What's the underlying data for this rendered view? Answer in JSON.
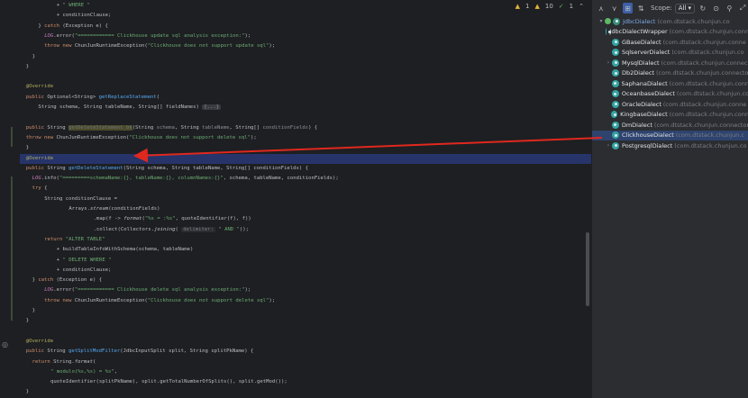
{
  "editor": {
    "inspections": {
      "warnings": "1",
      "weak_warnings": "10",
      "checks": "1"
    },
    "lines": [
      {
        "indent": 24,
        "parts": [
          [
            "op",
            "+ "
          ],
          [
            "str",
            "\" WHERE \""
          ]
        ]
      },
      {
        "indent": 24,
        "parts": [
          [
            "op",
            "+ conditionClause;"
          ]
        ]
      },
      {
        "indent": 12,
        "parts": [
          [
            "op",
            "} "
          ],
          [
            "kw",
            "catch"
          ],
          [
            "op",
            " (Exception e) {"
          ]
        ]
      },
      {
        "indent": 16,
        "parts": [
          [
            "lg",
            "LOG"
          ],
          [
            "op",
            ".error("
          ],
          [
            "str",
            "\"============ Clickhouse update sql analysis exception:\""
          ],
          [
            "op",
            ");"
          ]
        ]
      },
      {
        "indent": 16,
        "parts": [
          [
            "kw",
            "throw new "
          ],
          [
            "op",
            "ChunJunRuntimeException("
          ],
          [
            "str",
            "\"Clickhouse does not support update sql\""
          ],
          [
            "op",
            ");"
          ]
        ]
      },
      {
        "indent": 8,
        "parts": [
          [
            "op",
            "}"
          ]
        ]
      },
      {
        "indent": 4,
        "parts": [
          [
            "op",
            "}"
          ]
        ]
      },
      {
        "indent": 0,
        "parts": []
      },
      {
        "indent": 4,
        "parts": [
          [
            "ann",
            "@Override"
          ]
        ]
      },
      {
        "indent": 4,
        "parts": [
          [
            "kw",
            "public "
          ],
          [
            "op",
            "Optional<String> "
          ],
          [
            "fn",
            "getReplaceStatement"
          ],
          [
            "op",
            "("
          ]
        ]
      },
      {
        "indent": 12,
        "parts": [
          [
            "op",
            "String schema, String tableName, String[] fieldNames) "
          ],
          [
            "fold",
            "{...}"
          ]
        ]
      },
      {
        "indent": 0,
        "parts": []
      },
      {
        "indent": 4,
        "parts": [
          [
            "kw",
            "public "
          ],
          [
            "op",
            "String "
          ],
          [
            "unused",
            "getDeleteStatement_bk"
          ],
          [
            "op",
            "(String "
          ],
          [
            "par",
            "schema"
          ],
          [
            "op",
            ", String "
          ],
          [
            "par",
            "tableName"
          ],
          [
            "op",
            ", String[] "
          ],
          [
            "par",
            "conditionFields"
          ],
          [
            "op",
            ") {"
          ]
        ]
      },
      {
        "indent": 4,
        "parts": [
          [
            "kw",
            "throw new "
          ],
          [
            "op",
            "ChunJunRuntimeException("
          ],
          [
            "str",
            "\"Clickhouse does not support delete sql\""
          ],
          [
            "op",
            ");"
          ]
        ]
      },
      {
        "indent": 4,
        "parts": [
          [
            "op",
            "}"
          ]
        ]
      },
      {
        "indent": 4,
        "hl": true,
        "parts": [
          [
            "ann",
            "@Override"
          ]
        ]
      },
      {
        "indent": 4,
        "parts": [
          [
            "kw",
            "public "
          ],
          [
            "op",
            "String "
          ],
          [
            "fn",
            "getDeleteStatement"
          ],
          [
            "op",
            "(String schema, String tableName, String[] conditionFields) {"
          ]
        ]
      },
      {
        "indent": 8,
        "parts": [
          [
            "lg",
            "LOG"
          ],
          [
            "op",
            ".info("
          ],
          [
            "str",
            "\"=========schemaName:{}, tableName:{}, columnNames:{}\""
          ],
          [
            "op",
            ", schema, tableName, conditionFields);"
          ]
        ]
      },
      {
        "indent": 8,
        "parts": [
          [
            "kw",
            "try"
          ],
          [
            "op",
            " {"
          ]
        ]
      },
      {
        "indent": 16,
        "parts": [
          [
            "op",
            "String conditionClause ="
          ]
        ]
      },
      {
        "indent": 32,
        "parts": [
          [
            "op",
            "Arrays."
          ],
          [
            "it",
            "stream"
          ],
          [
            "op",
            "(conditionFields)"
          ]
        ]
      },
      {
        "indent": 48,
        "parts": [
          [
            "op",
            ".map(f -> "
          ],
          [
            "it",
            "format"
          ],
          [
            "op",
            "("
          ],
          [
            "str",
            "\"%s = :%s\""
          ],
          [
            "op",
            ", quoteIdentifier(f), f))"
          ]
        ]
      },
      {
        "indent": 48,
        "parts": [
          [
            "op",
            ".collect(Collectors."
          ],
          [
            "it",
            "joining"
          ],
          [
            "op",
            "( "
          ],
          [
            "hint",
            "delimiter:"
          ],
          [
            "str",
            " \" AND \""
          ],
          [
            "op",
            "));"
          ]
        ]
      },
      {
        "indent": 16,
        "parts": [
          [
            "kw",
            "return "
          ],
          [
            "str",
            "\"ALTER TABLE\""
          ]
        ]
      },
      {
        "indent": 24,
        "parts": [
          [
            "op",
            "+ buildTableInfoWithSchema(schema, tableName)"
          ]
        ]
      },
      {
        "indent": 24,
        "parts": [
          [
            "op",
            "+ "
          ],
          [
            "str",
            "\" DELETE WHERE \""
          ]
        ]
      },
      {
        "indent": 24,
        "parts": [
          [
            "op",
            "+ conditionClause;"
          ]
        ]
      },
      {
        "indent": 8,
        "parts": [
          [
            "op",
            "} "
          ],
          [
            "kw",
            "catch"
          ],
          [
            "op",
            " (Exception e) {"
          ]
        ]
      },
      {
        "indent": 16,
        "parts": [
          [
            "lg",
            "LOG"
          ],
          [
            "op",
            ".error("
          ],
          [
            "str",
            "\"============ Clickhouse delete sql analysis exception:\""
          ],
          [
            "op",
            ");"
          ]
        ]
      },
      {
        "indent": 16,
        "parts": [
          [
            "kw",
            "throw new "
          ],
          [
            "op",
            "ChunJunRuntimeException("
          ],
          [
            "str",
            "\"Clickhouse does not support delete sql\""
          ],
          [
            "op",
            ");"
          ]
        ]
      },
      {
        "indent": 8,
        "parts": [
          [
            "op",
            "}"
          ]
        ]
      },
      {
        "indent": 4,
        "parts": [
          [
            "op",
            "}"
          ]
        ]
      },
      {
        "indent": 0,
        "parts": []
      },
      {
        "indent": 4,
        "parts": [
          [
            "ann",
            "@Override"
          ]
        ]
      },
      {
        "indent": 4,
        "parts": [
          [
            "kw",
            "public "
          ],
          [
            "op",
            "String "
          ],
          [
            "fn",
            "getSplitModFilter"
          ],
          [
            "op",
            "(JdbcInputSplit split, String splitPkName) {"
          ]
        ]
      },
      {
        "indent": 8,
        "parts": [
          [
            "kw",
            "return "
          ],
          [
            "op",
            "String."
          ],
          [
            "it",
            "format"
          ],
          [
            "op",
            "("
          ]
        ]
      },
      {
        "indent": 20,
        "parts": [
          [
            "str",
            "\" modulo(%s,%s) = %s\""
          ],
          [
            "op",
            ","
          ]
        ]
      },
      {
        "indent": 20,
        "parts": [
          [
            "op",
            "quoteIdentifier(splitPkName), split.getTotalNumberOfSplits(), split.getMod());"
          ]
        ]
      },
      {
        "indent": 4,
        "parts": [
          [
            "op",
            "}"
          ]
        ]
      }
    ]
  },
  "panel": {
    "scope_label": "Scope:",
    "scope_value": "All",
    "items": [
      {
        "name": "JdbcDialect",
        "pkg": "(com.dtstack.chunjun.co",
        "root": true,
        "expanded": true,
        "selected": false,
        "arrow": true
      },
      {
        "name": "JdbcDialectWrapper",
        "pkg": "(com.dtstack.chunjun.conn",
        "root": false,
        "expanded": false,
        "selected": false,
        "arrow": false
      },
      {
        "name": "GBaseDialect",
        "pkg": "(com.dtstack.chunjun.conne",
        "root": false,
        "expanded": false,
        "selected": false,
        "arrow": false
      },
      {
        "name": "SqlserverDialect",
        "pkg": "(com.dtstack.chunjun.co",
        "root": false,
        "expanded": false,
        "selected": false,
        "arrow": false
      },
      {
        "name": "MysqlDialect",
        "pkg": "(com.dtstack.chunjun.connec",
        "root": false,
        "expanded": false,
        "selected": false,
        "arrow": true
      },
      {
        "name": "Db2Dialect",
        "pkg": "(com.dtstack.chunjun.connecto",
        "root": false,
        "expanded": false,
        "selected": false,
        "arrow": false
      },
      {
        "name": "SaphanaDialect",
        "pkg": "(com.dtstack.chunjun.conn",
        "root": false,
        "expanded": false,
        "selected": false,
        "arrow": false
      },
      {
        "name": "OceanbaseDialect",
        "pkg": "(com.dtstack.chunjun.co",
        "root": false,
        "expanded": false,
        "selected": false,
        "arrow": false
      },
      {
        "name": "OracleDialect",
        "pkg": "(com.dtstack.chunjun.conne",
        "root": false,
        "expanded": false,
        "selected": false,
        "arrow": false
      },
      {
        "name": "KingbaseDialect",
        "pkg": "(com.dtstack.chunjun.conn",
        "root": false,
        "expanded": false,
        "selected": false,
        "arrow": false
      },
      {
        "name": "DmDialect",
        "pkg": "(com.dtstack.chunjun.connector",
        "root": false,
        "expanded": false,
        "selected": false,
        "arrow": false
      },
      {
        "name": "ClickhouseDialect",
        "pkg": "(com.dtstack.chunjun.c",
        "root": false,
        "expanded": false,
        "selected": true,
        "arrow": false
      },
      {
        "name": "PostgresqlDialect",
        "pkg": "(com.dtstack.chunjun.co",
        "root": false,
        "expanded": false,
        "selected": false,
        "arrow": true
      }
    ]
  },
  "colors": {
    "accent": "#e0281e",
    "selection": "#2e436e",
    "highlight": "#26346a"
  }
}
